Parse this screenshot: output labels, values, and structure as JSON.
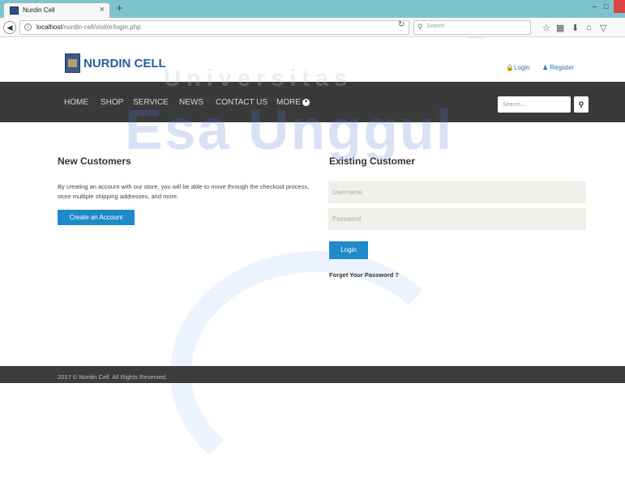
{
  "browser": {
    "tab_title": "Nurdin Cell",
    "tab_close": "×",
    "new_tab": "+",
    "url_host": "localhost",
    "url_path": "/nurdin-cell/visitor/login.php",
    "search_placeholder": "Search",
    "window_min": "‒",
    "window_max": "□"
  },
  "header": {
    "site_title": "NURDIN CELL",
    "login_label": "Login",
    "register_label": "Register"
  },
  "nav": {
    "items": [
      "HOME",
      "SHOP",
      "SERVICE",
      "NEWS",
      "CONTACT US",
      "MORE"
    ],
    "search_placeholder": "Search..."
  },
  "watermark": {
    "line1": "Universitas",
    "line2": "Esa Unggul"
  },
  "new_customers": {
    "title": "New Customers",
    "body": "By creating an account with our store, you will be able to move through the checkout process, store multiple shipping addresses, and more.",
    "button": "Create an Account"
  },
  "existing_customer": {
    "title": "Existing Customer",
    "username_placeholder": "Username",
    "password_placeholder": "Password",
    "login_button": "Login",
    "forgot_link": "Forget Your Password ?"
  },
  "footer": {
    "text": "2017 © Nurdin Cell. All Rights Reserved."
  },
  "colors": {
    "accent": "#1f8ac9",
    "nav_bg": "#3a3a3a",
    "brand": "#2a5d9f",
    "tab_strip": "#7ec4cf"
  }
}
